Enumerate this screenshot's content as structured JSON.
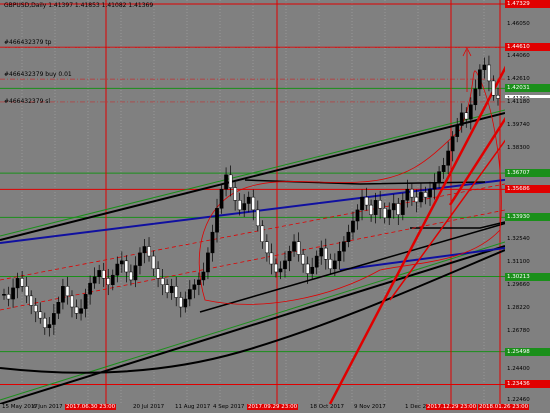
{
  "header": {
    "symbol_text": "GBPUSD,Daily  1.41397  1.41853  1.41082  1.41369"
  },
  "order_labels": [
    {
      "text": "#466432379 tp"
    },
    {
      "text": "#466432379 buy  0.01"
    },
    {
      "text": "#466432379 sl"
    }
  ],
  "price_axis": [
    {
      "text": "1.47329",
      "style": "red"
    },
    {
      "text": "1.46050",
      "style": "gray"
    },
    {
      "text": "1.44610",
      "style": "red"
    },
    {
      "text": "1.44060",
      "style": "gray"
    },
    {
      "text": "1.42610",
      "style": "gray"
    },
    {
      "text": "1.42031",
      "style": "green"
    },
    {
      "text": "1.41369",
      "style": "white"
    },
    {
      "text": "1.41180",
      "style": "gray"
    },
    {
      "text": "1.39740",
      "style": "gray"
    },
    {
      "text": "1.38300",
      "style": "gray"
    },
    {
      "text": "1.36707",
      "style": "green"
    },
    {
      "text": "1.35686",
      "style": "red"
    },
    {
      "text": "1.33930",
      "style": "green"
    },
    {
      "text": "1.32540",
      "style": "gray"
    },
    {
      "text": "1.31100",
      "style": "gray"
    },
    {
      "text": "1.30213",
      "style": "green"
    },
    {
      "text": "1.29660",
      "style": "gray"
    },
    {
      "text": "1.28220",
      "style": "gray"
    },
    {
      "text": "1.26780",
      "style": "gray"
    },
    {
      "text": "1.25498",
      "style": "green"
    },
    {
      "text": "1.24400",
      "style": "gray"
    },
    {
      "text": "1.23436",
      "style": "red"
    },
    {
      "text": "1.22460",
      "style": "gray"
    }
  ],
  "time_axis": [
    {
      "text": "15 May 2017",
      "style": "plain"
    },
    {
      "text": "6 Jun 2017",
      "style": "plain"
    },
    {
      "text": "2017.06.30 23:00",
      "style": "red"
    },
    {
      "text": "20 Jul 2017",
      "style": "plain"
    },
    {
      "text": "11 Aug 2017",
      "style": "plain"
    },
    {
      "text": "4 Sep 2017",
      "style": "plain"
    },
    {
      "text": "2017.09.29 23:00",
      "style": "red"
    },
    {
      "text": "18 Oct 2017",
      "style": "plain"
    },
    {
      "text": "9 Nov 2017",
      "style": "plain"
    },
    {
      "text": "1 Dec 2017",
      "style": "plain"
    },
    {
      "text": "2017.12.29 23:00",
      "style": "red"
    },
    {
      "text": "2018.01.26 23:00",
      "style": "red"
    }
  ],
  "chart_data": {
    "type": "candlestick",
    "symbol": "GBPUSD",
    "timeframe": "Daily",
    "ohlc_current": {
      "open": 1.41397,
      "high": 1.41853,
      "low": 1.41082,
      "close": 1.41369
    },
    "y_range": [
      1.2246,
      1.4733
    ],
    "x_range": [
      "15 May 2017",
      "2018.01.26"
    ],
    "horizontal_levels": [
      {
        "price": 1.47329,
        "color": "#e00000"
      },
      {
        "price": 1.4461,
        "color": "#e00000"
      },
      {
        "price": 1.42031,
        "color": "#1a8f1a"
      },
      {
        "price": 1.36707,
        "color": "#1a8f1a"
      },
      {
        "price": 1.35686,
        "color": "#e00000"
      },
      {
        "price": 1.3393,
        "color": "#1a8f1a"
      },
      {
        "price": 1.30213,
        "color": "#1a8f1a"
      },
      {
        "price": 1.25498,
        "color": "#1a8f1a"
      },
      {
        "price": 1.23436,
        "color": "#e00000"
      }
    ],
    "vertical_markers": [
      "2017.06.30 23:00",
      "2017.09.29 23:00",
      "2017.12.29 23:00",
      "2018.01.26 23:00"
    ],
    "order_levels": [
      {
        "label": "#466432379 tp",
        "price": 1.4461
      },
      {
        "label": "#466432379 buy 0.01",
        "price": 1.4261
      },
      {
        "label": "#466432379 sl",
        "price": 1.4118
      }
    ],
    "close_series": [
      1.291,
      1.288,
      1.295,
      1.301,
      1.296,
      1.29,
      1.284,
      1.28,
      1.276,
      1.27,
      1.272,
      1.279,
      1.286,
      1.296,
      1.29,
      1.283,
      1.279,
      1.282,
      1.291,
      1.298,
      1.302,
      1.306,
      1.301,
      1.297,
      1.303,
      1.31,
      1.312,
      1.305,
      1.3,
      1.309,
      1.317,
      1.321,
      1.315,
      1.307,
      1.301,
      1.297,
      1.292,
      1.296,
      1.289,
      1.283,
      1.288,
      1.294,
      1.297,
      1.3,
      1.305,
      1.317,
      1.33,
      1.345,
      1.357,
      1.366,
      1.358,
      1.35,
      1.344,
      1.348,
      1.352,
      1.344,
      1.334,
      1.324,
      1.317,
      1.31,
      1.305,
      1.307,
      1.312,
      1.318,
      1.324,
      1.316,
      1.31,
      1.304,
      1.308,
      1.315,
      1.32,
      1.313,
      1.307,
      1.312,
      1.318,
      1.324,
      1.33,
      1.337,
      1.344,
      1.352,
      1.347,
      1.341,
      1.35,
      1.345,
      1.339,
      1.344,
      1.348,
      1.341,
      1.35,
      1.357,
      1.352,
      1.349,
      1.355,
      1.352,
      1.357,
      1.361,
      1.368,
      1.372,
      1.381,
      1.39,
      1.397,
      1.405,
      1.401,
      1.41,
      1.42,
      1.432,
      1.435,
      1.425,
      1.416,
      1.414
    ]
  }
}
